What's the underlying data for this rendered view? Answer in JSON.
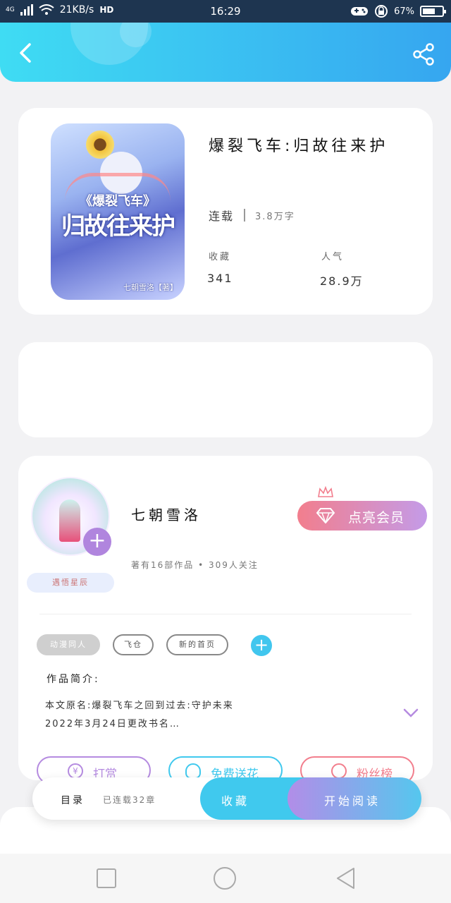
{
  "status_bar": {
    "network": "4G",
    "speed": "21KB/s",
    "hd": "HD",
    "time": "16:29",
    "battery": "67%",
    "battery_level": 0.67
  },
  "book": {
    "title": "爆裂飞车:归故往来护",
    "cover_series": "《爆裂飞车》",
    "cover_title": "归故往来护",
    "cover_author": "七朝雪洛【著】",
    "status": "连载",
    "word_count": "3.8万字",
    "favorites_label": "收藏",
    "favorites_value": "341",
    "popularity_label": "人气",
    "popularity_value": "28.9万"
  },
  "author": {
    "name": "七朝雪洛",
    "info": "著有16部作品 • 309人关注",
    "badge": "遇悟星辰",
    "vip_label": "点亮会员"
  },
  "tags": [
    "动漫同人",
    "飞仓",
    "新的首页"
  ],
  "intro": {
    "heading": "作品简介:",
    "line1": "本文原名:爆裂飞车之回到过去:守护未来",
    "line2": "2022年3月24日更改书名…"
  },
  "actions": {
    "reward": "打赏",
    "flowers": "免费送花",
    "fans": "粉丝榜"
  },
  "bottom_bar": {
    "toc": "目录",
    "updated": "已连载32章",
    "favorite": "收藏",
    "read": "开始阅读"
  },
  "colors": {
    "header_start": "#3fdcf3",
    "header_end": "#36a6f0",
    "accent_cyan": "#40c9ee",
    "accent_purple": "#b085de",
    "accent_pink": "#f27e8d"
  }
}
